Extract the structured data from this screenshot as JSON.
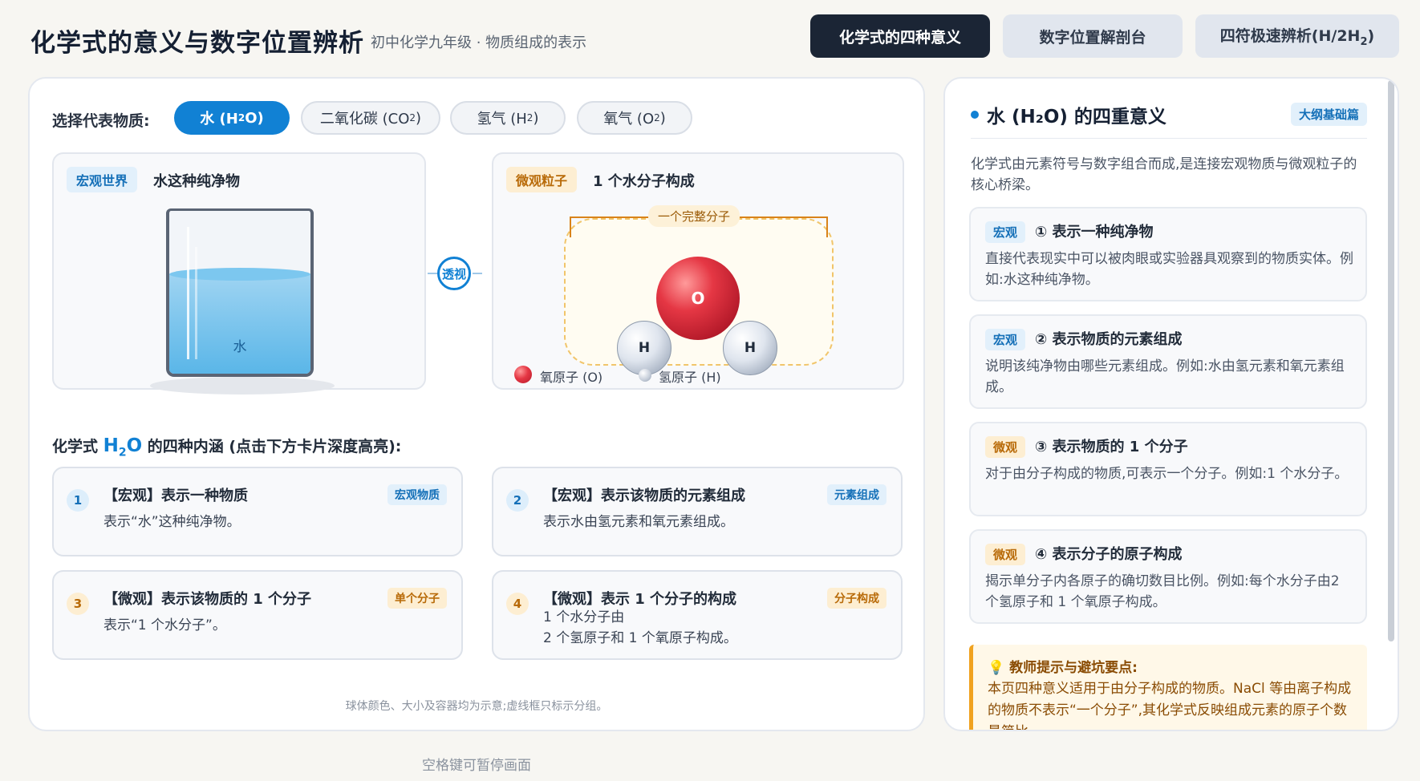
{
  "header": {
    "title": "化学式的意义与数字位置辨析",
    "subtitle": "初中化学九年级 · 物质组成的表示",
    "tabs": [
      {
        "label": "化学式的四种意义",
        "active": true
      },
      {
        "label": "数字位置解剖台",
        "active": false
      },
      {
        "label_main": "四符极速辨析(H/2H",
        "label_sub": "2",
        "label_end": ")",
        "active": false
      }
    ]
  },
  "selector": {
    "label": "选择代表物质:",
    "chips": [
      {
        "main": "水 (H",
        "sub": "2",
        "end": "O)",
        "active": true
      },
      {
        "main": "二氧化碳 (CO",
        "sub": "2",
        "end": ")",
        "active": false
      },
      {
        "main": "氢气 (H",
        "sub": "2",
        "end": ")",
        "active": false
      },
      {
        "main": "氧气 (O",
        "sub": "2",
        "end": ")",
        "active": false
      }
    ]
  },
  "macro_box": {
    "tag": "宏观世界",
    "heading": "水这种纯净物",
    "water_label": "水"
  },
  "perspective_label": "透视",
  "micro_box": {
    "tag": "微观粒子",
    "heading": "1 个水分子构成",
    "bracket_label": "一个完整分子",
    "atom_o": "O",
    "atom_h": "H",
    "legend_o": "氧原子 (O)",
    "legend_h": "氢原子 (H)",
    "colors": {
      "oxygen": "#e53744",
      "hydrogen": "#dfe5ee"
    }
  },
  "section": {
    "prefix": "化学式 ",
    "formula_main": "H",
    "formula_sub": "2",
    "formula_end": "O",
    "suffix": " 的四种内涵 (点击下方卡片深度高亮):"
  },
  "cards": [
    {
      "num": "1",
      "title": "【宏观】表示一种物质",
      "tag": "宏观物质",
      "body1": "表示“水”这种纯净物。",
      "body2": ""
    },
    {
      "num": "2",
      "title": "【宏观】表示该物质的元素组成",
      "tag": "元素组成",
      "body1": "表示水由氢元素和氧元素组成。",
      "body2": ""
    },
    {
      "num": "3",
      "title": "【微观】表示该物质的 1 个分子",
      "tag": "单个分子",
      "body1": "表示“1 个水分子”。",
      "body2": ""
    },
    {
      "num": "4",
      "title": "【微观】表示 1 个分子的构成",
      "tag": "分子构成",
      "body1": "1 个水分子由",
      "body2": "2 个氢原子和 1 个氧原子构成。"
    }
  ],
  "footnote": "球体颜色、大小及容器均为示意;虚线框只标示分组。",
  "space_hint": "空格键可暂停画面",
  "right_panel": {
    "title": "水 (H₂O) 的四重意义",
    "badge": "大纲基础篇",
    "intro": "化学式由元素符号与数字组合而成,是连接宏观物质与微观粒子的核心桥梁。",
    "meanings": [
      {
        "tag": "宏观",
        "title": "① 表示一种纯净物",
        "body": "直接代表现实中可以被肉眼或实验器具观察到的物质实体。例如:水这种纯净物。"
      },
      {
        "tag": "宏观",
        "title": "② 表示物质的元素组成",
        "body": "说明该纯净物由哪些元素组成。例如:水由氢元素和氧元素组成。"
      },
      {
        "tag": "微观",
        "title": "③ 表示物质的 1 个分子",
        "body": "对于由分子构成的物质,可表示一个分子。例如:1 个水分子。"
      },
      {
        "tag": "微观",
        "title": "④ 表示分子的原子构成",
        "body": "揭示单分子内各原子的确切数目比例。例如:每个水分子由2 个氢原子和 1 个氧原子构成。"
      }
    ],
    "tip_title": "💡 教师提示与避坑要点:",
    "tip_body": "本页四种意义适用于由分子构成的物质。NaCl 等由离子构成的物质不表示“一个分子”,其化学式反映组成元素的原子个数最简比。"
  }
}
